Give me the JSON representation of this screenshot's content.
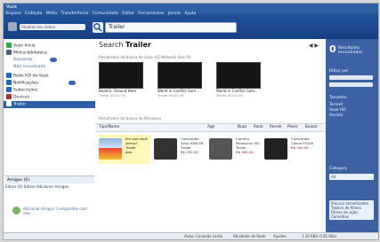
{
  "window": {
    "title": "Vuze"
  },
  "menu": {
    "items": [
      "Arquivo",
      "Exibição",
      "Mídia",
      "Transferência",
      "Comunidade",
      "Editar",
      "Ferramentas",
      "Janela",
      "Ajuda"
    ]
  },
  "toolbar": {
    "status_placeholder": "Atualize seu status",
    "search_value": "Trailer"
  },
  "sidebar": {
    "items": [
      {
        "label": "Vuze Início",
        "icon": "home-icon",
        "color": "#37a34a"
      },
      {
        "label": "Minha biblioteca",
        "icon": "library-icon",
        "color": "#4b5f80"
      },
      {
        "label": "Baixando",
        "icon": "download-icon",
        "color": "#2c6bd0",
        "sub": true
      },
      {
        "label": "Não visualizado",
        "icon": "new-icon",
        "color": "#2c6bd0",
        "sub": true
      },
      {
        "label": "Rede HD da Vuze",
        "icon": "hd-icon",
        "color": "#1e66c8"
      },
      {
        "label": "Notificações",
        "icon": "bell-icon",
        "color": "#1e66c8"
      },
      {
        "label": "Subscrições",
        "icon": "rss-icon",
        "color": "#1e66c8"
      },
      {
        "label": "Devices",
        "icon": "devices-icon",
        "color": "#a33"
      },
      {
        "label": "Trailer",
        "icon": "search-icon",
        "color": "#2d5fa8",
        "active": true
      }
    ],
    "friends": {
      "title": "Amigos (0)",
      "actions": "Editar (0)   Editar   Adicionar Amigos",
      "invite_text": "Adicionar Amigos: Compartilhe com eles"
    }
  },
  "main": {
    "title_prefix": "Search",
    "title_query": "Trailer",
    "section1": "Resultados da busca do Vuze HD Network    See All",
    "thumbs": [
      {
        "title": "Beatrix: Around Here",
        "meta": "Trailer  00:02:00"
      },
      {
        "title": "World in Conflict Sam...",
        "meta": "Trailer  00:01:30"
      },
      {
        "title": "World in Conflict Sam...",
        "meta": "Trailer  00:01:30"
      }
    ],
    "section2": "Resultados da busca do Mininova",
    "table_headers": [
      "Tipo/Nome",
      "Age",
      "Buzz",
      "Rank",
      "Rende",
      "Peers",
      "Baixar"
    ],
    "results": [
      {
        "lines": [
          "Em que você pensa?",
          "Trailer",
          "Adv"
        ]
      },
      {
        "lines": [
          "Camcorder",
          "Sony HDR-SR",
          "Trailer",
          "R$ 250.00"
        ]
      },
      {
        "lines": [
          "Camera",
          "Panasonic HD",
          "Trailer",
          "R$ 380.00"
        ]
      },
      {
        "lines": [
          "Camcorder",
          "Canon FS100",
          "R$ 240.00"
        ]
      }
    ]
  },
  "right_panel": {
    "count": "0",
    "line1": "Resultados",
    "line2": "encontrados",
    "filter_label": "Filtrar por",
    "size_label": "Tamanho",
    "checks": [
      "Torrent",
      "Vuze HD",
      "Assistir"
    ],
    "category_label": "Category",
    "category_value": "All",
    "list_header": "Procura semelhantes",
    "list_items": [
      "Trailers de filmes",
      "Filmes de ação",
      "Comédias"
    ]
  },
  "statusbar": {
    "left": "Aviso: Conexão Lenta",
    "mid1": "Atividade de Rede",
    "mid2": "Ajustes",
    "right": "1.20 KB/s  0.81 KB/s"
  },
  "colors": {
    "accent": "#2d5fa8",
    "panel": "#3c62a3"
  }
}
